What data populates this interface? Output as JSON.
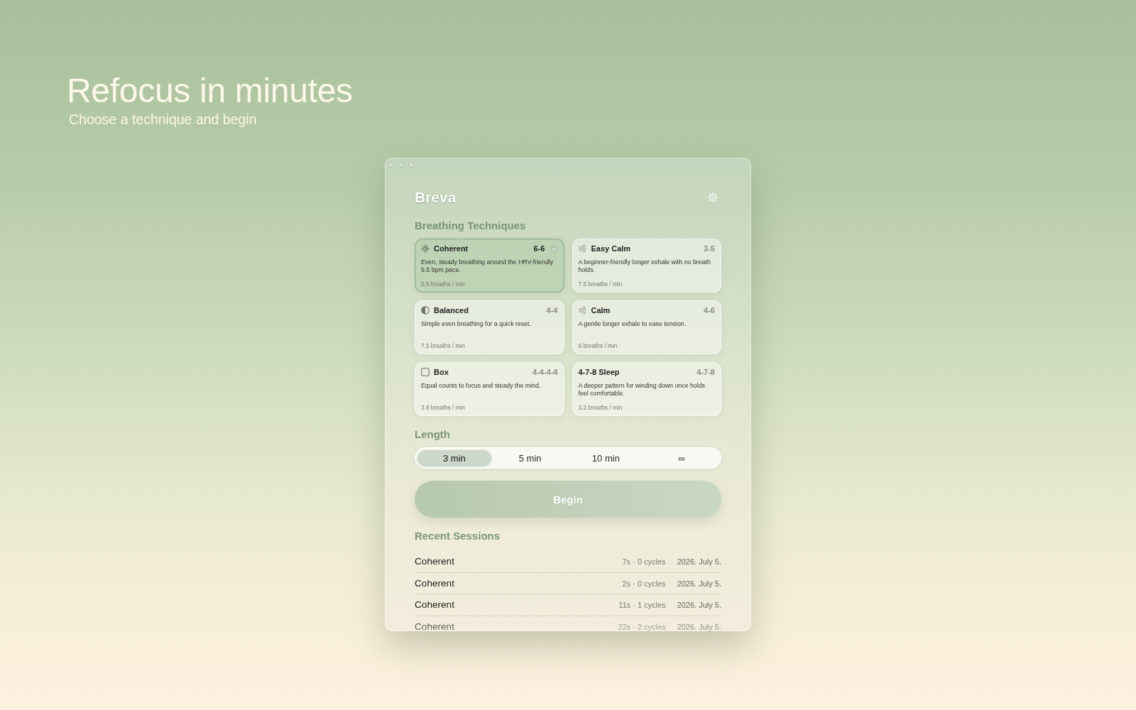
{
  "hero": {
    "title": "Refocus in minutes",
    "subtitle": "Choose a technique and begin"
  },
  "window": {
    "title": "Breva",
    "techniques": {
      "heading": "Breathing Techniques",
      "items": [
        {
          "kind": "sun",
          "name": "Coherent",
          "pattern": "6-6",
          "description": "Even, steady breathing around the HRV-friendly 5.5 bpm pace.",
          "rate": "5.5 breaths / min",
          "selected": true
        },
        {
          "kind": "wind",
          "name": "Easy Calm",
          "pattern": "3-5",
          "description": "A beginner-friendly longer exhale with no breath holds.",
          "rate": "7.5 breaths / min",
          "selected": false
        },
        {
          "kind": "half-circle",
          "name": "Balanced",
          "pattern": "4-4",
          "description": "Simple even breathing for a quick reset.",
          "rate": "7.5 breaths / min",
          "selected": false
        },
        {
          "kind": "wind",
          "name": "Calm",
          "pattern": "4-6",
          "description": "A gentle longer exhale to ease tension.",
          "rate": "6 breaths / min",
          "selected": false
        },
        {
          "kind": "square",
          "name": "Box",
          "pattern": "4-4-4-4",
          "description": "Equal counts to focus and steady the mind.",
          "rate": "3.8 breaths / min",
          "selected": false
        },
        {
          "kind": "plain",
          "name": "4-7-8 Sleep",
          "pattern": "4-7-8",
          "description": "A deeper pattern for winding down once holds feel comfortable.",
          "rate": "3.2 breaths / min",
          "selected": false
        }
      ]
    },
    "length": {
      "heading": "Length",
      "options": [
        {
          "label": "3 min",
          "selected": true
        },
        {
          "label": "5 min",
          "selected": false
        },
        {
          "label": "10 min",
          "selected": false
        },
        {
          "label": "∞",
          "selected": false
        }
      ]
    },
    "begin_button": "Begin",
    "recent_sessions": {
      "heading": "Recent Sessions",
      "rows": [
        {
          "name": "Coherent",
          "details": "7s · 0 cycles",
          "date": "2026. July 5."
        },
        {
          "name": "Coherent",
          "details": "2s · 0 cycles",
          "date": "2026. July 5."
        },
        {
          "name": "Coherent",
          "details": "11s · 1 cycles",
          "date": "2026. July 5."
        },
        {
          "name": "Coherent",
          "details": "22s · 2 cycles",
          "date": "2026. July 5."
        }
      ]
    }
  }
}
